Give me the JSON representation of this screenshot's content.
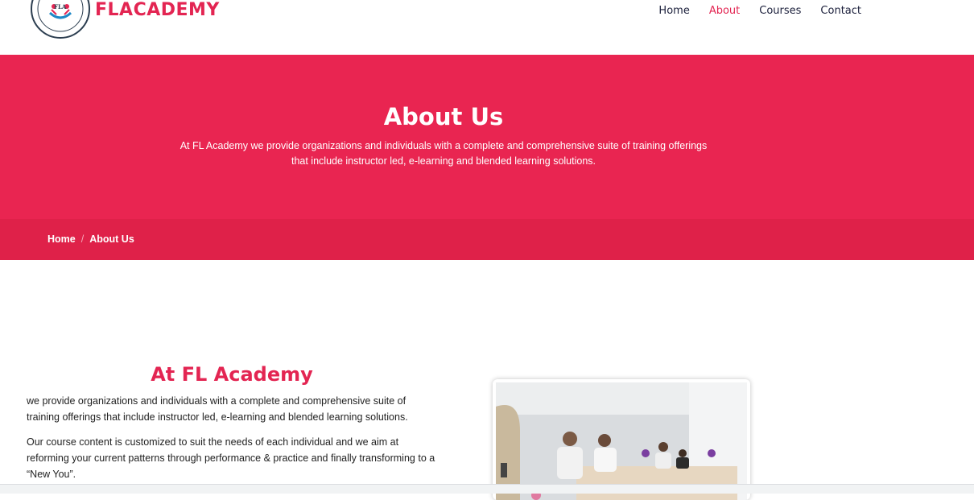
{
  "header": {
    "brand": "FLACADEMY",
    "logo_text": "FLA",
    "nav": [
      {
        "label": "Home",
        "active": false
      },
      {
        "label": "About",
        "active": true
      },
      {
        "label": "Courses",
        "active": false
      },
      {
        "label": "Contact",
        "active": false
      }
    ]
  },
  "hero": {
    "title": "About Us",
    "text_line1": "At FL Academy we provide organizations and individuals with a complete and comprehensive suite of training offerings",
    "text_line2": "that include instructor led, e-learning and blended learning solutions."
  },
  "breadcrumb": {
    "home": "Home",
    "separator": "/",
    "current": "About Us"
  },
  "content": {
    "title": "At FL Academy",
    "para1": "we provide organizations and individuals with a complete and comprehensive suite of training offerings that include instructor led, e-learning and blended learning solutions.",
    "para2": "Our course content is customized to suit the needs of each individual and we aim at reforming your current patterns through performance & practice and finally transforming to a “New You”."
  },
  "colors": {
    "accent": "#e92551",
    "breadcrumb_bg": "#df2149",
    "nav_text": "#1b1f3b"
  }
}
